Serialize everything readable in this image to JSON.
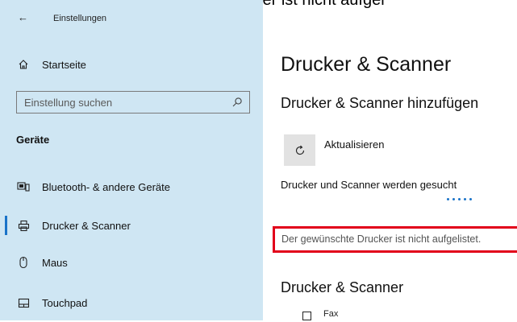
{
  "caption": "Hier nun auf „Der gewünschte Drucker ist nicht aufgel",
  "sidebar": {
    "back_icon": "back-arrow-icon",
    "title": "Einstellungen",
    "home_label": "Startseite",
    "search_placeholder": "Einstellung suchen",
    "section_label": "Geräte",
    "items": [
      {
        "label": "Bluetooth- & andere Geräte",
        "icon": "bluetooth-devices-icon"
      },
      {
        "label": "Drucker & Scanner",
        "icon": "printer-icon",
        "active": true
      },
      {
        "label": "Maus",
        "icon": "mouse-icon"
      },
      {
        "label": "Touchpad",
        "icon": "touchpad-icon"
      }
    ]
  },
  "main": {
    "title": "Drucker & Scanner",
    "add_heading": "Drucker & Scanner hinzufügen",
    "refresh_label": "Aktualisieren",
    "searching_text": "Drucker und Scanner werden gesucht",
    "not_listed_link": "Der gewünschte Drucker ist nicht aufgelistet.",
    "section2_title": "Drucker & Scanner",
    "devices": [
      {
        "label": "Fax"
      }
    ]
  },
  "colors": {
    "sidebar_bg": "#cfe6f3",
    "accent": "#1a73c8",
    "highlight": "#e2001a"
  }
}
